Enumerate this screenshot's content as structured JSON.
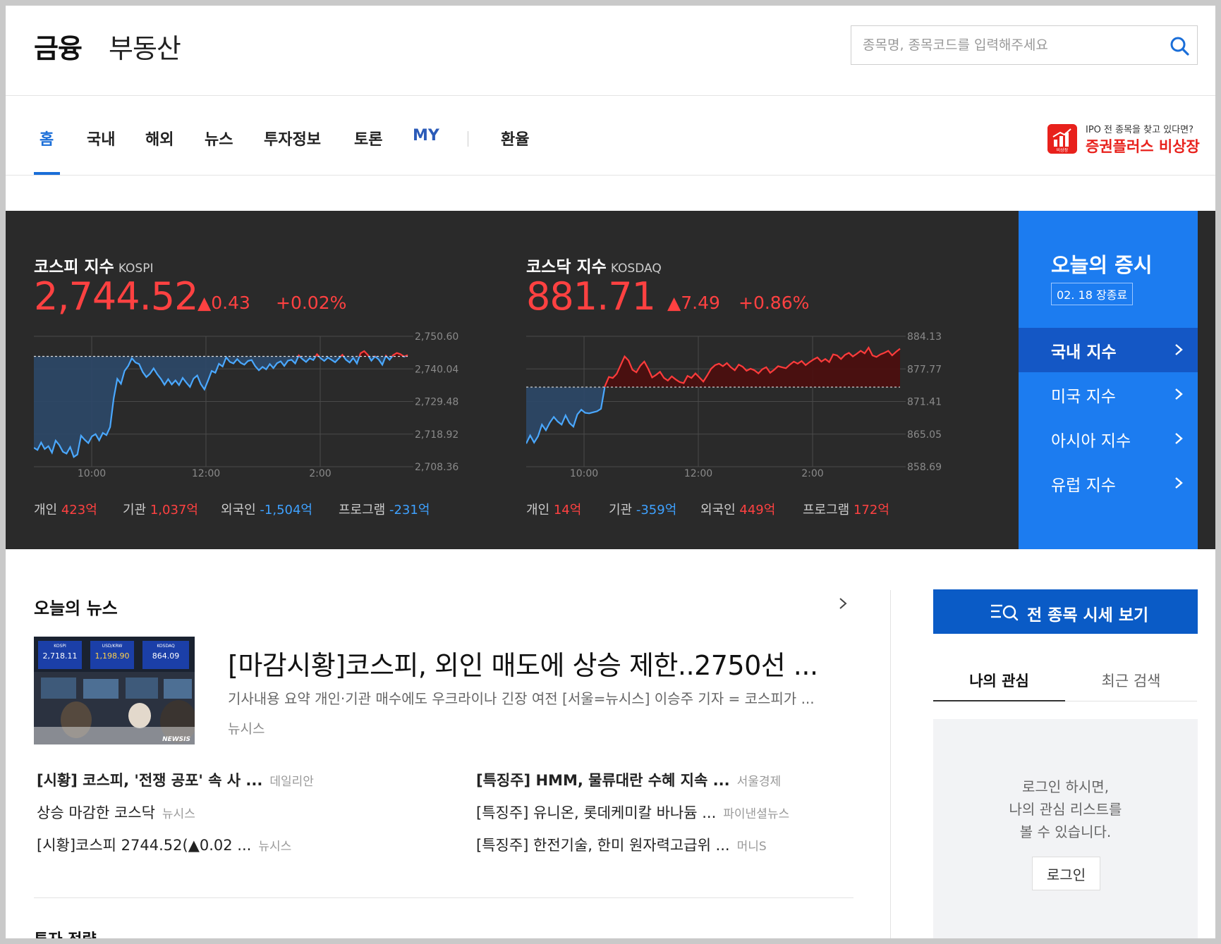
{
  "header": {
    "brand_finance": "금융",
    "brand_realestate": "부동산",
    "search_placeholder": "종목명, 종목코드를 입력해주세요"
  },
  "nav": {
    "items": [
      "홈",
      "국내",
      "해외",
      "뉴스",
      "투자정보",
      "토론",
      "MY",
      "환율"
    ],
    "active": "홈"
  },
  "ad": {
    "subtitle": "IPO 전 종목을 찾고 있다면?",
    "title": "증권플러스 비상장",
    "logo_text": "비상장"
  },
  "market": {
    "kospi": {
      "name": "코스피 지수",
      "en": "KOSPI",
      "value": "2,744.52",
      "change": "▲0.43",
      "pct": "+0.02%",
      "y_ticks": [
        "2,750.60",
        "2,740.04",
        "2,729.48",
        "2,718.92",
        "2,708.36"
      ],
      "x_ticks": [
        "10:00",
        "12:00",
        "2:00"
      ],
      "flows": [
        {
          "label": "개인",
          "value": "423",
          "unit": "억",
          "dir": "up"
        },
        {
          "label": "기관",
          "value": "1,037",
          "unit": "억",
          "dir": "up"
        },
        {
          "label": "외국인",
          "value": "-1,504",
          "unit": "억",
          "dir": "dn"
        },
        {
          "label": "프로그램",
          "value": "-231",
          "unit": "억",
          "dir": "dn"
        }
      ]
    },
    "kosdaq": {
      "name": "코스닥 지수",
      "en": "KOSDAQ",
      "value": "881.71",
      "change": "▲7.49",
      "pct": "+0.86%",
      "y_ticks": [
        "884.13",
        "877.77",
        "871.41",
        "865.05",
        "858.69"
      ],
      "x_ticks": [
        "10:00",
        "12:00",
        "2:00"
      ],
      "flows": [
        {
          "label": "개인",
          "value": "14",
          "unit": "억",
          "dir": "up"
        },
        {
          "label": "기관",
          "value": "-359",
          "unit": "억",
          "dir": "dn"
        },
        {
          "label": "외국인",
          "value": "449",
          "unit": "억",
          "dir": "up"
        },
        {
          "label": "프로그램",
          "value": "172",
          "unit": "억",
          "dir": "up"
        }
      ]
    },
    "today": {
      "title": "오늘의 증시",
      "date": "02. 18 장종료",
      "items": [
        "국내 지수",
        "미국 지수",
        "아시아 지수",
        "유럽 지수"
      ],
      "selected": "국내 지수"
    },
    "colors": {
      "up": "#ff4141",
      "down": "#3ea1ff",
      "panel": "#2a2a2a",
      "accent": "#1c7cf0"
    }
  },
  "news": {
    "title": "오늘의 뉴스",
    "headline": "[마감시황]코스피, 외인 매도에 상승 제한..2750선 ...",
    "summary": "기사내용 요약 개인·기관 매수에도 우크라이나 긴장 여전 [서울=뉴시스] 이승주 기자 = 코스피가 ...",
    "source": "뉴시스",
    "image_text": {
      "board1": "2,718.11",
      "board2": "1,198.90",
      "board3": "864.09",
      "watermark": "NEWSIS",
      "b1": "KOSPI",
      "b2": "USD/KRW",
      "b3": "KOSDAQ"
    },
    "left_list": [
      {
        "title": "[시황] 코스피, '전쟁 공포' 속 사 ...",
        "src": "데일리안",
        "bold": true
      },
      {
        "title": "상승 마감한 코스닥",
        "src": "뉴시스",
        "bold": false
      },
      {
        "title": "[시황]코스피 2744.52(▲0.02 ...",
        "src": "뉴시스",
        "bold": false
      }
    ],
    "right_list": [
      {
        "title": "[특징주] HMM, 물류대란 수혜 지속 ...",
        "src": "서울경제",
        "bold": true
      },
      {
        "title": "[특징주] 유니온, 롯데케미칼 바나듐 ...",
        "src": "파이낸셜뉴스",
        "bold": false
      },
      {
        "title": "[특징주] 한전기술, 한미 원자력고급위 ...",
        "src": "머니S",
        "bold": false
      }
    ],
    "next_section": "투자 전략"
  },
  "side": {
    "all_button": "전 종목 시세 보기",
    "tabs": [
      "나의 관심",
      "최근 검색"
    ],
    "login_msg": [
      "로그인 하시면,",
      "나의 관심 리스트를",
      "볼 수 있습니다."
    ],
    "login_button": "로그인"
  },
  "chart_data": [
    {
      "type": "line",
      "title": "코스피 지수",
      "x_ticks": [
        "10:00",
        "12:00",
        "2:00"
      ],
      "ylim": [
        2708.36,
        2750.6
      ],
      "baseline": 2744.09,
      "series": [
        {
          "name": "KOSPI",
          "values": [
            2714.5,
            2713.8,
            2716.2,
            2714.1,
            2715.0,
            2712.9,
            2716.8,
            2715.4,
            2713.2,
            2712.6,
            2714.7,
            2711.5,
            2712.3,
            2718.4,
            2717.1,
            2716.0,
            2718.2,
            2718.9,
            2716.9,
            2719.3,
            2718.6,
            2721.2,
            2730.5,
            2736.8,
            2735.2,
            2739.4,
            2741.0,
            2743.5,
            2742.1,
            2741.6,
            2739.0,
            2737.4,
            2738.5,
            2740.2,
            2738.3,
            2736.8,
            2734.9,
            2736.7,
            2735.0,
            2736.3,
            2734.8,
            2737.1,
            2735.6,
            2734.2,
            2736.9,
            2737.9,
            2735.1,
            2733.4,
            2736.3,
            2739.4,
            2738.8,
            2741.7,
            2740.8,
            2743.8,
            2742.3,
            2741.8,
            2743.2,
            2742.0,
            2741.4,
            2742.6,
            2742.9,
            2740.9,
            2739.6,
            2740.7,
            2739.9,
            2741.6,
            2740.3,
            2741.9,
            2742.5,
            2741.0,
            2742.7,
            2743.0,
            2741.8,
            2744.4,
            2743.2,
            2742.3,
            2743.5,
            2742.9,
            2744.8,
            2743.5,
            2742.6,
            2743.7,
            2743.0,
            2742.2,
            2743.4,
            2744.6,
            2743.0,
            2742.1,
            2743.6,
            2741.8,
            2745.1,
            2745.8,
            2744.6,
            2742.7,
            2744.1,
            2743.1,
            2741.4,
            2744.3,
            2743.0,
            2744.5,
            2745.2,
            2744.8,
            2744.0,
            2744.52
          ]
        }
      ]
    },
    {
      "type": "line",
      "title": "코스닥 지수",
      "x_ticks": [
        "10:00",
        "12:00",
        "2:00"
      ],
      "ylim": [
        858.69,
        884.13
      ],
      "baseline": 874.22,
      "series": [
        {
          "name": "KOSDAQ",
          "values": [
            863.2,
            864.8,
            863.4,
            864.6,
            866.9,
            865.8,
            867.3,
            868.4,
            867.5,
            866.9,
            868.7,
            867.2,
            866.5,
            868.9,
            869.8,
            869.2,
            869.1,
            869.3,
            869.5,
            870.0,
            874.4,
            876.2,
            876.0,
            876.8,
            878.5,
            880.2,
            879.4,
            877.6,
            877.1,
            878.4,
            879.2,
            877.8,
            876.1,
            876.6,
            877.2,
            876.0,
            875.5,
            876.3,
            875.7,
            875.2,
            875.0,
            876.4,
            876.0,
            876.9,
            876.1,
            875.3,
            876.5,
            877.8,
            878.5,
            878.8,
            878.3,
            878.9,
            878.1,
            877.5,
            878.6,
            878.2,
            877.4,
            877.8,
            877.5,
            876.9,
            877.7,
            878.1,
            877.0,
            877.6,
            878.3,
            878.1,
            877.9,
            878.6,
            879.2,
            878.8,
            879.3,
            878.5,
            879.1,
            879.6,
            880.0,
            879.2,
            879.7,
            879.1,
            880.6,
            880.4,
            879.7,
            880.5,
            880.9,
            880.2,
            880.7,
            881.3,
            880.8,
            881.9,
            880.4,
            880.1,
            880.6,
            880.9,
            881.3,
            880.4,
            881.1,
            881.71
          ]
        }
      ]
    }
  ]
}
